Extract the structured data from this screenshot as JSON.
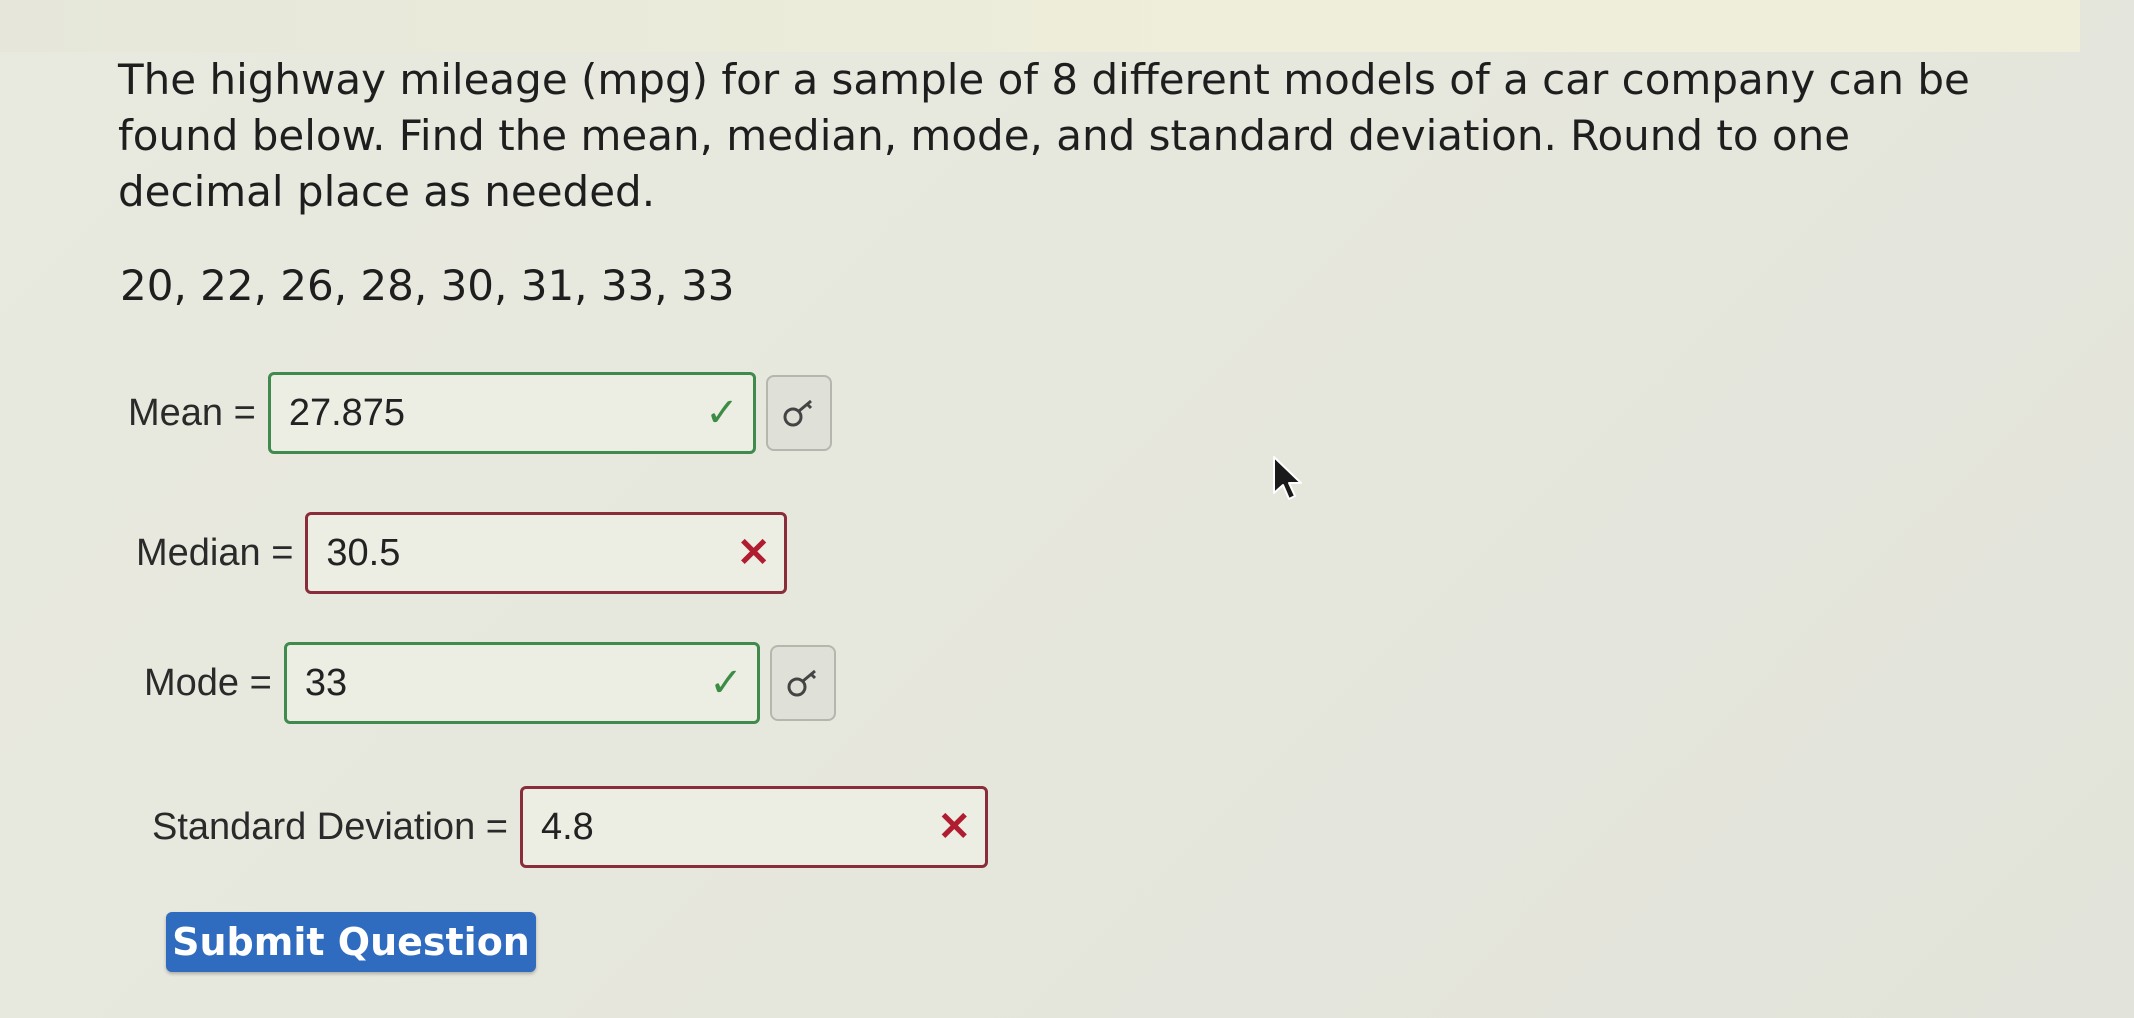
{
  "question": {
    "text": "The highway mileage (mpg) for a sample of 8 different models of a car company can be found below. Find the mean, median, mode, and standard deviation. Round to one decimal place as needed.",
    "data_values": "20, 22, 26, 28, 30, 31, 33, 33"
  },
  "answers": {
    "mean": {
      "label": "Mean =",
      "value": "27.875",
      "status": "correct",
      "status_icon": "check-icon",
      "key_icon": "key-icon"
    },
    "median": {
      "label": "Median =",
      "value": "30.5",
      "status": "incorrect",
      "status_icon": "cross-icon"
    },
    "mode": {
      "label": "Mode =",
      "value": "33",
      "status": "correct",
      "status_icon": "check-icon",
      "key_icon": "key-icon"
    },
    "std_dev": {
      "label": "Standard Deviation =",
      "value": "4.8",
      "status": "incorrect",
      "status_icon": "cross-icon"
    }
  },
  "submit": {
    "label": "Submit Question"
  },
  "colors": {
    "correct_border": "#3f8a4c",
    "incorrect_border": "#8a2d3a",
    "submit_bg": "#2f6bbf"
  },
  "glyphs": {
    "check": "✓",
    "cross": "✕"
  }
}
